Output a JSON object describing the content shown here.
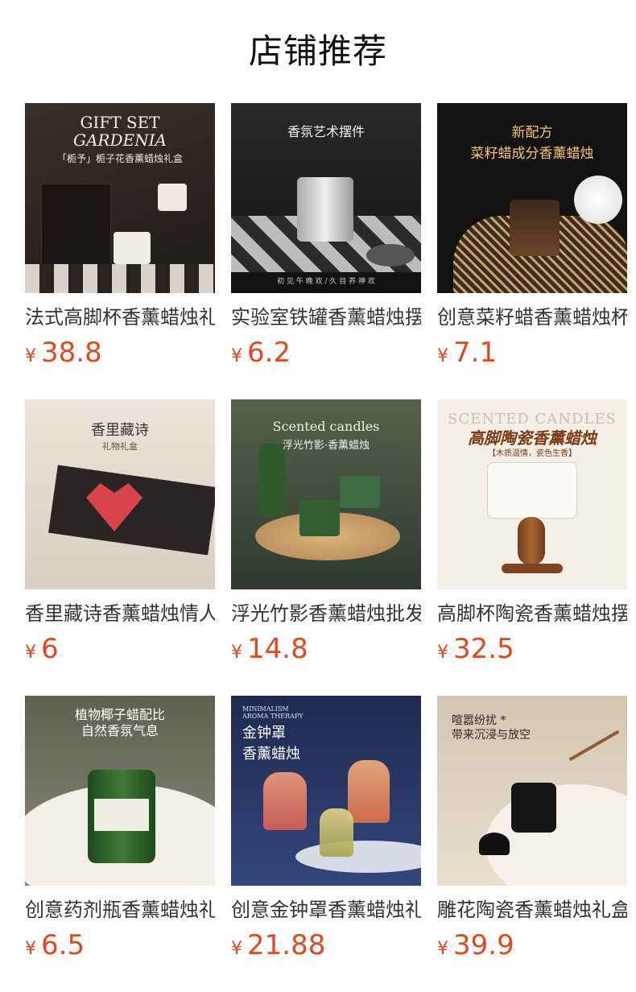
{
  "page_title": "店铺推荐",
  "currency_symbol": "¥",
  "products": [
    {
      "name": "法式高脚杯香薰蜡烛礼盒",
      "price": "38.8",
      "img_text": [
        "GIFT SET",
        "GARDENIA",
        "「栀予」栀子花香薰蜡烛礼盒"
      ],
      "colors": [
        "#2b2420",
        "#4a3d35",
        "#e9e4dc"
      ]
    },
    {
      "name": "实验室铁罐香薰蜡烛摆件",
      "price": "6.2",
      "img_text": [
        "香氛艺术摆件",
        "",
        "初 见 午 晚 欢 / 久 目 养 神 欢"
      ],
      "colors": [
        "#1d1d1d",
        "#3b3b3b",
        "#c9c9c9"
      ]
    },
    {
      "name": "创意菜籽蜡香薰蜡烛杯",
      "price": "7.1",
      "img_text": [
        "新配方",
        "菜籽蜡成分香薰蜡烛",
        ""
      ],
      "colors": [
        "#141414",
        "#2c2621",
        "#e8b45a"
      ]
    },
    {
      "name": "香里藏诗香薰蜡烛情人节",
      "price": "6",
      "img_text": [
        "香里藏诗",
        "礼物礼盒",
        ""
      ],
      "colors": [
        "#e9e2d7",
        "#d6cbbd",
        "#c8373f"
      ]
    },
    {
      "name": "浮光竹影香薰蜡烛批发",
      "price": "14.8",
      "img_text": [
        "Scented candles",
        "浮光竹影·香薰蜡烛",
        ""
      ],
      "colors": [
        "#3e4a3e",
        "#6a7a66",
        "#c7a36d"
      ]
    },
    {
      "name": "高脚杯陶瓷香薰蜡烛摆件",
      "price": "32.5",
      "img_text": [
        "SCENTED CANDLES",
        "高脚陶瓷香薰蜡烛",
        "【木质温情，瓷色生香】"
      ],
      "colors": [
        "#f4efe7",
        "#e6ddd0",
        "#8a4f23"
      ]
    },
    {
      "name": "创意药剂瓶香薰蜡烛礼盒",
      "price": "6.5",
      "img_text": [
        "植物椰子蜡配比",
        "自然香氛气息",
        ""
      ],
      "colors": [
        "#6b6b5e",
        "#efebe4",
        "#2f5e2b"
      ]
    },
    {
      "name": "创意金钟罩香薰蜡烛礼盒",
      "price": "21.88",
      "img_text": [
        "金钟罩",
        "香薰蜡烛",
        "MINIMALISM AROMA THERAPY"
      ],
      "colors": [
        "#1f2a4d",
        "#3a4a7a",
        "#e98a6b"
      ]
    },
    {
      "name": "雕花陶瓷香薰蜡烛礼盒",
      "price": "39.9",
      "img_text": [
        "喧嚣纷扰 *",
        "带来沉浸与放空",
        ""
      ],
      "colors": [
        "#d9cdb9",
        "#f2ece3",
        "#1a1a1a"
      ]
    }
  ]
}
